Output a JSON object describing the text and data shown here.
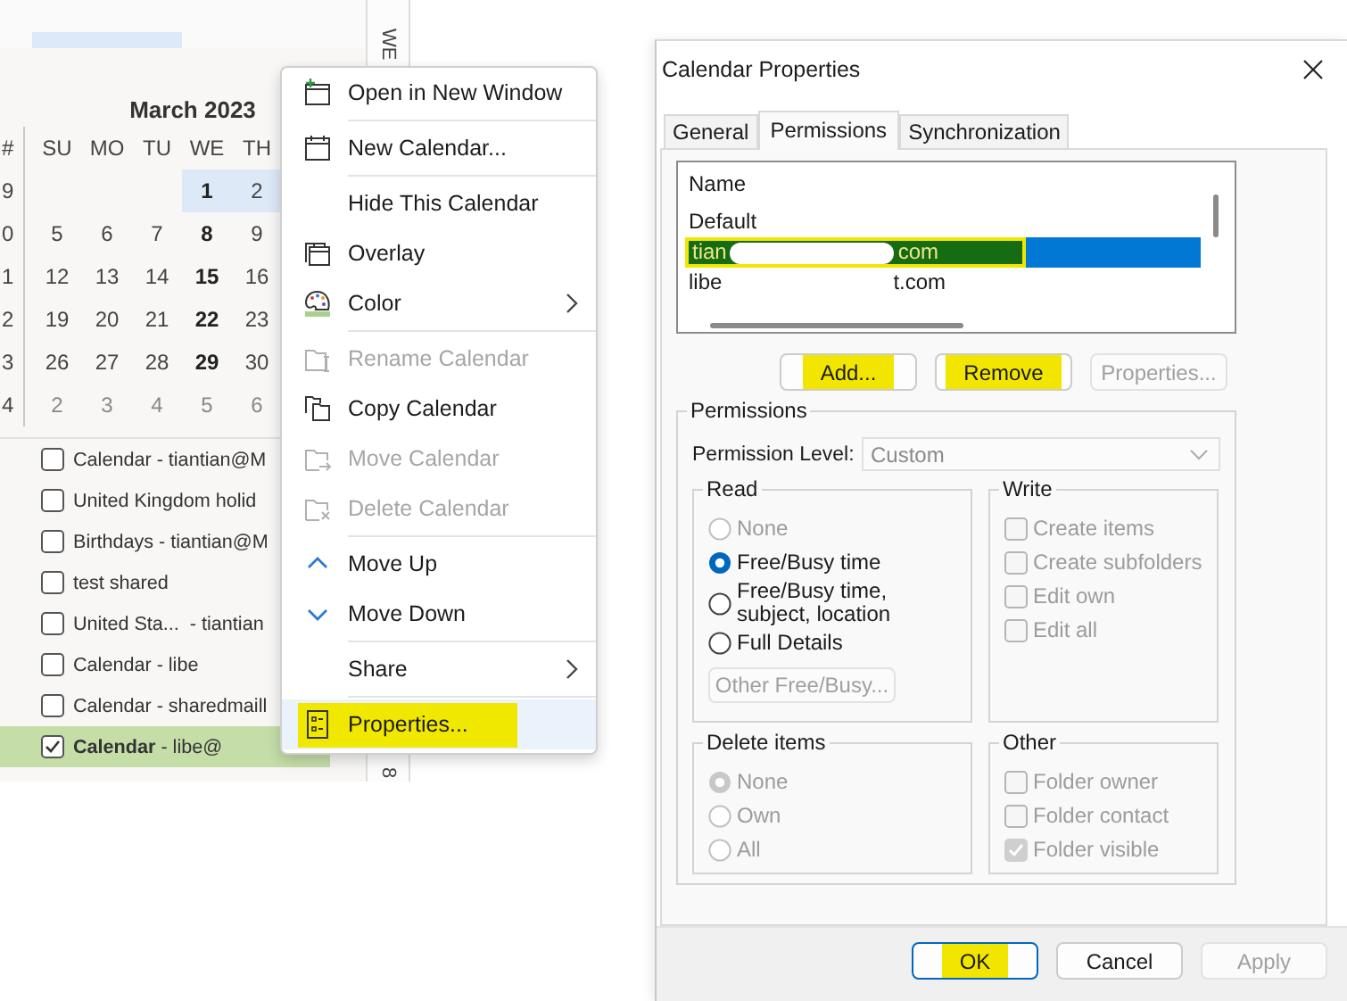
{
  "outlook": {
    "side_tab_labels": [
      "WE",
      "8"
    ],
    "mini_calendar": {
      "title": "March 2023",
      "week_header": "#",
      "day_headers": [
        "SU",
        "MO",
        "TU",
        "WE",
        "TH"
      ],
      "weeks": [
        {
          "week": "9",
          "days": [
            {
              "day": "1",
              "bold": true,
              "muted": false,
              "selected": true
            },
            {
              "day": "2",
              "bold": false,
              "muted": false,
              "selected": true
            }
          ]
        },
        {
          "week": "0",
          "days": [
            {
              "day": "5",
              "bold": false,
              "muted": false,
              "selected": false
            },
            {
              "day": "6",
              "bold": false,
              "muted": false,
              "selected": false
            },
            {
              "day": "7",
              "bold": false,
              "muted": false,
              "selected": false
            },
            {
              "day": "8",
              "bold": true,
              "muted": false,
              "selected": false
            },
            {
              "day": "9",
              "bold": false,
              "muted": false,
              "selected": false
            }
          ]
        },
        {
          "week": "1",
          "days": [
            {
              "day": "12",
              "bold": false,
              "muted": false,
              "selected": false
            },
            {
              "day": "13",
              "bold": false,
              "muted": false,
              "selected": false
            },
            {
              "day": "14",
              "bold": false,
              "muted": false,
              "selected": false
            },
            {
              "day": "15",
              "bold": true,
              "muted": false,
              "selected": false
            },
            {
              "day": "16",
              "bold": false,
              "muted": false,
              "selected": false
            }
          ]
        },
        {
          "week": "2",
          "days": [
            {
              "day": "19",
              "bold": false,
              "muted": false,
              "selected": false
            },
            {
              "day": "20",
              "bold": false,
              "muted": false,
              "selected": false
            },
            {
              "day": "21",
              "bold": false,
              "muted": false,
              "selected": false
            },
            {
              "day": "22",
              "bold": true,
              "muted": false,
              "selected": false
            },
            {
              "day": "23",
              "bold": false,
              "muted": false,
              "selected": false
            }
          ]
        },
        {
          "week": "3",
          "days": [
            {
              "day": "26",
              "bold": false,
              "muted": false,
              "selected": false
            },
            {
              "day": "27",
              "bold": false,
              "muted": false,
              "selected": false
            },
            {
              "day": "28",
              "bold": false,
              "muted": false,
              "selected": false
            },
            {
              "day": "29",
              "bold": true,
              "muted": false,
              "selected": false
            },
            {
              "day": "30",
              "bold": false,
              "muted": false,
              "selected": false
            }
          ]
        },
        {
          "week": "4",
          "days": [
            {
              "day": "2",
              "bold": false,
              "muted": true,
              "selected": false
            },
            {
              "day": "3",
              "bold": false,
              "muted": true,
              "selected": false
            },
            {
              "day": "4",
              "bold": false,
              "muted": true,
              "selected": false
            },
            {
              "day": "5",
              "bold": false,
              "muted": true,
              "selected": false
            },
            {
              "day": "6",
              "bold": false,
              "muted": true,
              "selected": false
            }
          ]
        }
      ]
    },
    "calendars": [
      {
        "label": "Calendar - tiantian@M",
        "checked": false,
        "selected": false
      },
      {
        "label": "United Kingdom holid",
        "checked": false,
        "selected": false
      },
      {
        "label": "Birthdays - tiantian@M",
        "checked": false,
        "selected": false
      },
      {
        "label": "test shared",
        "checked": false,
        "selected": false
      },
      {
        "label": "United Sta...  - tiantian",
        "checked": false,
        "selected": false
      },
      {
        "label": "Calendar - libe",
        "checked": false,
        "selected": false
      },
      {
        "label": "Calendar - sharedmaill",
        "checked": false,
        "selected": false
      },
      {
        "label": "**Calendar** - libe@",
        "checked": true,
        "selected": true
      }
    ]
  },
  "context_menu": {
    "items": [
      {
        "kind": "item",
        "label": "Open in New Window",
        "disabled": false,
        "submenu": false,
        "selected": false,
        "highlighted": false
      },
      {
        "kind": "separator"
      },
      {
        "kind": "item",
        "label": "New Calendar...",
        "disabled": false,
        "submenu": false,
        "selected": false,
        "highlighted": false
      },
      {
        "kind": "separator"
      },
      {
        "kind": "item",
        "label": "Hide This Calendar",
        "disabled": false,
        "submenu": false,
        "selected": false,
        "highlighted": false
      },
      {
        "kind": "item",
        "label": "Overlay",
        "disabled": false,
        "submenu": false,
        "selected": false,
        "highlighted": false
      },
      {
        "kind": "item",
        "label": "Color",
        "disabled": false,
        "submenu": true,
        "selected": false,
        "highlighted": false
      },
      {
        "kind": "separator"
      },
      {
        "kind": "item",
        "label": "Rename Calendar",
        "disabled": true,
        "submenu": false,
        "selected": false,
        "highlighted": false
      },
      {
        "kind": "item",
        "label": "Copy Calendar",
        "disabled": false,
        "submenu": false,
        "selected": false,
        "highlighted": false
      },
      {
        "kind": "item",
        "label": "Move Calendar",
        "disabled": true,
        "submenu": false,
        "selected": false,
        "highlighted": false
      },
      {
        "kind": "item",
        "label": "Delete Calendar",
        "disabled": true,
        "submenu": false,
        "selected": false,
        "highlighted": false
      },
      {
        "kind": "separator"
      },
      {
        "kind": "item",
        "label": "Move Up",
        "disabled": false,
        "submenu": false,
        "selected": false,
        "highlighted": false
      },
      {
        "kind": "item",
        "label": "Move Down",
        "disabled": false,
        "submenu": false,
        "selected": false,
        "highlighted": false
      },
      {
        "kind": "separator"
      },
      {
        "kind": "item",
        "label": "Share",
        "disabled": false,
        "submenu": true,
        "selected": false,
        "highlighted": false
      },
      {
        "kind": "separator"
      },
      {
        "kind": "item",
        "label": "Properties...",
        "disabled": false,
        "submenu": false,
        "selected": true,
        "highlighted": true
      }
    ]
  },
  "dialog": {
    "title": "Calendar Properties",
    "tabs": [
      {
        "label": "General",
        "selected": false
      },
      {
        "label": "Permissions",
        "selected": true
      },
      {
        "label": "Synchronization",
        "selected": false
      }
    ],
    "permissions_list": {
      "header": "Name",
      "rows": [
        {
          "name_parts": [
            "Default"
          ],
          "selected": false,
          "highlighted": false
        },
        {
          "name_parts": [
            "tian",
            "com"
          ],
          "selected": true,
          "highlighted": true
        },
        {
          "name_parts": [
            "libe",
            "t.com"
          ],
          "selected": false,
          "highlighted": false
        }
      ]
    },
    "list_buttons": [
      {
        "label": "Add...",
        "disabled": false,
        "highlighted": true
      },
      {
        "label": "Remove",
        "disabled": false,
        "highlighted": true
      },
      {
        "label": "Properties...",
        "disabled": true,
        "highlighted": false
      }
    ],
    "permissions": {
      "title": "Permissions",
      "level_label": "Permission Level:",
      "level_value": "Custom",
      "level_disabled": true,
      "groups": [
        {
          "title": "Read",
          "kind": "radio",
          "items": [
            {
              "label": "None",
              "selected": false,
              "disabled": true
            },
            {
              "label": "Free/Busy time",
              "selected": true,
              "disabled": false
            },
            {
              "label": "Free/Busy time, subject, location",
              "selected": false,
              "disabled": false
            },
            {
              "label": "Full Details",
              "selected": false,
              "disabled": false
            }
          ],
          "button": {
            "label": "Other Free/Busy...",
            "disabled": true
          }
        },
        {
          "title": "Write",
          "kind": "checkbox",
          "items": [
            {
              "label": "Create items",
              "checked": false,
              "disabled": true
            },
            {
              "label": "Create subfolders",
              "checked": false,
              "disabled": true
            },
            {
              "label": "Edit own",
              "checked": false,
              "disabled": true
            },
            {
              "label": "Edit all",
              "checked": false,
              "disabled": true
            }
          ]
        },
        {
          "title": "Delete items",
          "kind": "radio",
          "items": [
            {
              "label": "None",
              "selected": true,
              "disabled": true
            },
            {
              "label": "Own",
              "selected": false,
              "disabled": true
            },
            {
              "label": "All",
              "selected": false,
              "disabled": true
            }
          ]
        },
        {
          "title": "Other",
          "kind": "checkbox",
          "items": [
            {
              "label": "Folder owner",
              "checked": false,
              "disabled": true
            },
            {
              "label": "Folder contact",
              "checked": false,
              "disabled": true
            },
            {
              "label": "Folder visible",
              "checked": true,
              "disabled": true
            }
          ]
        }
      ]
    },
    "footer_buttons": [
      {
        "label": "OK",
        "default": true,
        "disabled": false,
        "highlighted": true
      },
      {
        "label": "Cancel",
        "default": false,
        "disabled": false,
        "highlighted": false
      },
      {
        "label": "Apply",
        "default": false,
        "disabled": true,
        "highlighted": false
      }
    ]
  }
}
